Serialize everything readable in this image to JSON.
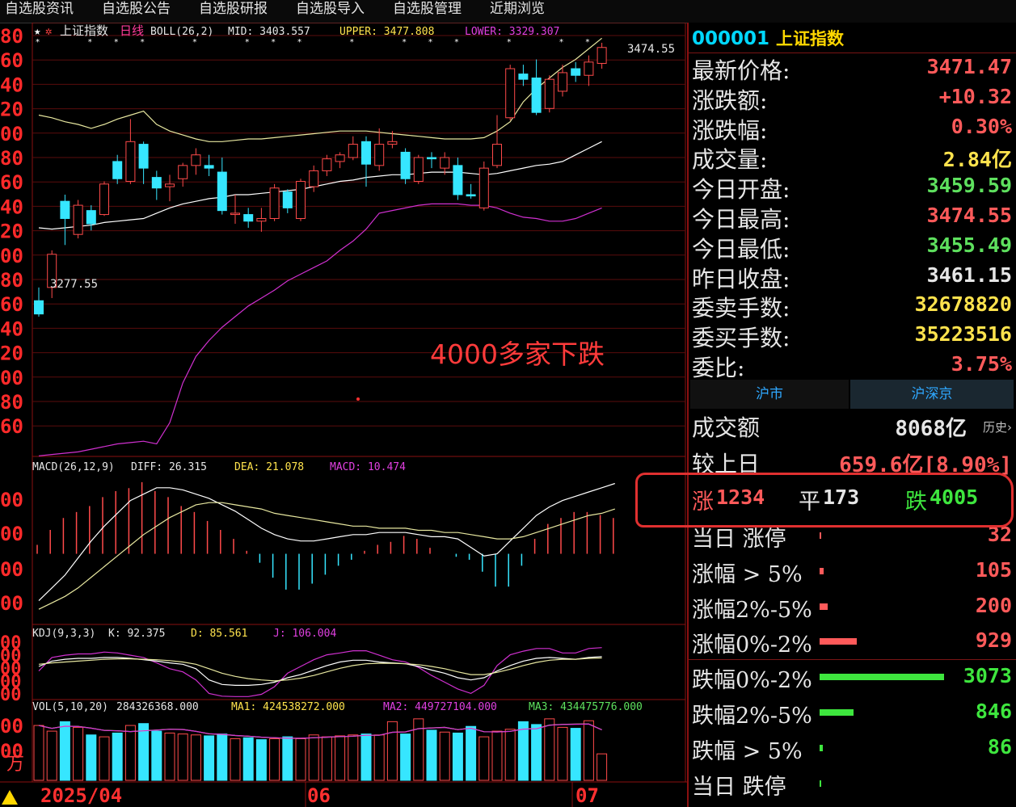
{
  "menu": [
    "自选股资讯",
    "自选股公告",
    "自选股研报",
    "自选股导入",
    "自选股管理",
    "近期浏览"
  ],
  "main_chart": {
    "star_label": "★",
    "title": "上证指数",
    "period": "日线",
    "indicator": "BOLL(26,2)",
    "mid": "MID: 3403.557",
    "upper": "UPPER: 3477.808",
    "lower": "LOWER: 3329.307",
    "high_marker": "3474.55",
    "low_marker": "3277.55",
    "y_tick_labels": [
      "80",
      "60",
      "40",
      "20",
      "00",
      "80",
      "60",
      "40",
      "20",
      "00",
      "80",
      "60",
      "40",
      "20",
      "00",
      "80",
      "60"
    ],
    "candles": [
      {
        "o": 3280,
        "c": 3270,
        "h": 3290,
        "l": 3268
      },
      {
        "o": 3290,
        "c": 3315,
        "h": 3318,
        "l": 3282
      },
      {
        "o": 3355,
        "c": 3342,
        "h": 3360,
        "l": 3322
      },
      {
        "o": 3330,
        "c": 3352,
        "h": 3356,
        "l": 3327
      },
      {
        "o": 3348,
        "c": 3338,
        "h": 3352,
        "l": 3333
      },
      {
        "o": 3345,
        "c": 3368,
        "h": 3370,
        "l": 3344
      },
      {
        "o": 3385,
        "c": 3372,
        "h": 3390,
        "l": 3368
      },
      {
        "o": 3370,
        "c": 3400,
        "h": 3417,
        "l": 3368
      },
      {
        "o": 3398,
        "c": 3380,
        "h": 3400,
        "l": 3368
      },
      {
        "o": 3373,
        "c": 3365,
        "h": 3378,
        "l": 3356
      },
      {
        "o": 3366,
        "c": 3368,
        "h": 3375,
        "l": 3355
      },
      {
        "o": 3372,
        "c": 3382,
        "h": 3384,
        "l": 3366
      },
      {
        "o": 3382,
        "c": 3390,
        "h": 3395,
        "l": 3375
      },
      {
        "o": 3382,
        "c": 3380,
        "h": 3390,
        "l": 3374
      },
      {
        "o": 3377,
        "c": 3348,
        "h": 3388,
        "l": 3345
      },
      {
        "o": 3345,
        "c": 3346,
        "h": 3360,
        "l": 3338
      },
      {
        "o": 3345,
        "c": 3340,
        "h": 3350,
        "l": 3335
      },
      {
        "o": 3340,
        "c": 3342,
        "h": 3350,
        "l": 3332
      },
      {
        "o": 3342,
        "c": 3365,
        "h": 3368,
        "l": 3340
      },
      {
        "o": 3362,
        "c": 3350,
        "h": 3364,
        "l": 3346
      },
      {
        "o": 3342,
        "c": 3370,
        "h": 3372,
        "l": 3340
      },
      {
        "o": 3366,
        "c": 3378,
        "h": 3382,
        "l": 3362
      },
      {
        "o": 3378,
        "c": 3387,
        "h": 3390,
        "l": 3374
      },
      {
        "o": 3385,
        "c": 3390,
        "h": 3392,
        "l": 3380
      },
      {
        "o": 3388,
        "c": 3398,
        "h": 3404,
        "l": 3386
      },
      {
        "o": 3400,
        "c": 3383,
        "h": 3404,
        "l": 3366
      },
      {
        "o": 3382,
        "c": 3398,
        "h": 3410,
        "l": 3378
      },
      {
        "o": 3398,
        "c": 3400,
        "h": 3408,
        "l": 3395
      },
      {
        "o": 3392,
        "c": 3372,
        "h": 3395,
        "l": 3368
      },
      {
        "o": 3370,
        "c": 3388,
        "h": 3390,
        "l": 3368
      },
      {
        "o": 3388,
        "c": 3387,
        "h": 3392,
        "l": 3380
      },
      {
        "o": 3380,
        "c": 3388,
        "h": 3392,
        "l": 3375
      },
      {
        "o": 3382,
        "c": 3360,
        "h": 3388,
        "l": 3356
      },
      {
        "o": 3360,
        "c": 3359,
        "h": 3368,
        "l": 3357
      },
      {
        "o": 3350,
        "c": 3380,
        "h": 3385,
        "l": 3348
      },
      {
        "o": 3382,
        "c": 3398,
        "h": 3420,
        "l": 3380
      },
      {
        "o": 3418,
        "c": 3455,
        "h": 3458,
        "l": 3416
      },
      {
        "o": 3451,
        "c": 3447,
        "h": 3458,
        "l": 3442
      },
      {
        "o": 3448,
        "c": 3422,
        "h": 3462,
        "l": 3420
      },
      {
        "o": 3425,
        "c": 3447,
        "h": 3450,
        "l": 3422
      },
      {
        "o": 3438,
        "c": 3452,
        "h": 3458,
        "l": 3434
      },
      {
        "o": 3455,
        "c": 3450,
        "h": 3460,
        "l": 3445
      },
      {
        "o": 3450,
        "c": 3460,
        "h": 3465,
        "l": 3442
      },
      {
        "o": 3459,
        "c": 3471,
        "h": 3474.55,
        "l": 3455
      }
    ],
    "mid_line": [
      3335,
      3334,
      3335,
      3336,
      3337,
      3339,
      3340,
      3341,
      3342,
      3346,
      3350,
      3353,
      3355,
      3357,
      3358,
      3360,
      3360,
      3361,
      3362,
      3363,
      3364,
      3366,
      3368,
      3370,
      3371,
      3373,
      3374,
      3375,
      3375,
      3376,
      3377,
      3377,
      3377,
      3376,
      3375,
      3376,
      3378,
      3380,
      3382,
      3383,
      3385,
      3390,
      3395,
      3400
    ],
    "upper_line": [
      3420,
      3418,
      3415,
      3413,
      3410,
      3413,
      3417,
      3420,
      3423,
      3413,
      3408,
      3405,
      3402,
      3400,
      3400,
      3401,
      3402,
      3402,
      3403,
      3404,
      3405,
      3406,
      3407,
      3408,
      3408,
      3408,
      3407,
      3406,
      3405,
      3404,
      3403,
      3402,
      3402,
      3402,
      3403,
      3408,
      3415,
      3430,
      3440,
      3448,
      3456,
      3462,
      3470,
      3478
    ],
    "lower_line": [
      3163,
      3164,
      3165,
      3166,
      3168,
      3170,
      3172,
      3173,
      3174,
      3172,
      3188,
      3218,
      3238,
      3250,
      3260,
      3268,
      3276,
      3282,
      3288,
      3295,
      3300,
      3305,
      3310,
      3318,
      3325,
      3334,
      3346,
      3348,
      3350,
      3352,
      3353,
      3353,
      3353,
      3352,
      3352,
      3350,
      3346,
      3343,
      3342,
      3340,
      3340,
      3342,
      3346,
      3350
    ],
    "annotation": "4000多家下跌"
  },
  "macd": {
    "label": "MACD(26,12,9)",
    "diff": "DIFF: 26.315",
    "dea": "DEA: 21.078",
    "macd": "MACD: 10.474",
    "y_tick_labels": [
      "00",
      "00",
      "00",
      "00"
    ],
    "hist": [
      3,
      8,
      12,
      14,
      16,
      19,
      21,
      22,
      24,
      21,
      19,
      16,
      14,
      11,
      8,
      5,
      1,
      -3,
      -8,
      -12,
      -12,
      -10,
      -7,
      -4,
      -2,
      1,
      3,
      4,
      6,
      5,
      2,
      0,
      -1,
      -2,
      -6,
      -11,
      -11,
      -4,
      5,
      10,
      12,
      14,
      14,
      13,
      12
    ],
    "diff_line": [
      -22,
      -16,
      -10,
      -2,
      6,
      13,
      19,
      25,
      28,
      31,
      31,
      30,
      28,
      26,
      23,
      20,
      16,
      12,
      9,
      7,
      6,
      6,
      7,
      8,
      9,
      9,
      10,
      10,
      10,
      9,
      8,
      8,
      7,
      3,
      -1,
      0,
      6,
      12,
      18,
      22,
      25,
      27,
      29,
      31,
      33
    ],
    "dea_line": [
      -26,
      -23,
      -20,
      -16,
      -11,
      -6,
      -1,
      4,
      9,
      13,
      17,
      20,
      23,
      24,
      24,
      23,
      22,
      21,
      19,
      18,
      17,
      16,
      15,
      14,
      13,
      13,
      12,
      12,
      12,
      11,
      11,
      10,
      10,
      9,
      8,
      7,
      7,
      8,
      10,
      12,
      14,
      16,
      18,
      19,
      21
    ]
  },
  "kdj": {
    "label": "KDJ(9,3,3)",
    "k": "K: 92.375",
    "d": "D: 85.561",
    "j": "J: 106.004",
    "y_tick_labels": [
      "00",
      "00",
      "00",
      "00",
      "00"
    ],
    "k_line": [
      70,
      82,
      86,
      88,
      88,
      90,
      90,
      88,
      85,
      82,
      78,
      75,
      65,
      40,
      30,
      28,
      28,
      30,
      35,
      45,
      52,
      62,
      72,
      80,
      84,
      84,
      80,
      78,
      76,
      70,
      62,
      55,
      45,
      40,
      45,
      60,
      72,
      82,
      88,
      90,
      88,
      86,
      90,
      92
    ],
    "d_line": [
      75,
      78,
      80,
      82,
      84,
      86,
      87,
      87,
      86,
      85,
      83,
      80,
      75,
      65,
      55,
      48,
      43,
      40,
      38,
      40,
      44,
      50,
      58,
      66,
      72,
      76,
      77,
      77,
      76,
      74,
      70,
      65,
      58,
      52,
      52,
      57,
      64,
      72,
      79,
      84,
      86,
      86,
      88,
      89
    ],
    "j_line": [
      60,
      90,
      95,
      98,
      98,
      102,
      100,
      95,
      90,
      78,
      65,
      58,
      40,
      10,
      4,
      3,
      3,
      8,
      25,
      55,
      70,
      85,
      96,
      100,
      105,
      105,
      95,
      85,
      80,
      68,
      50,
      35,
      20,
      10,
      28,
      72,
      96,
      104,
      110,
      110,
      100,
      100,
      110,
      112
    ]
  },
  "vol": {
    "label": "VOL(5,10,20)",
    "value": "284326368.000",
    "ma1": "MA1: 424538272.000",
    "ma2": "MA2: 449727104.000",
    "ma3": "MA3: 434475776.000",
    "y_tick_labels": [
      "00",
      "00"
    ],
    "unit": "万",
    "bars": [
      5.8,
      5.2,
      6.2,
      5.6,
      4.8,
      4.6,
      5.0,
      5.8,
      6.0,
      5.2,
      5.0,
      4.9,
      4.8,
      4.7,
      4.9,
      4.4,
      4.5,
      4.3,
      4.4,
      4.6,
      4.4,
      4.8,
      4.6,
      4.7,
      4.8,
      4.9,
      4.8,
      6.2,
      4.9,
      6.5,
      5.3,
      5.1,
      5.0,
      5.7,
      4.6,
      5.2,
      5.4,
      6.2,
      5.9,
      6.5,
      5.6,
      5.5,
      6.3,
      2.8
    ],
    "up": [
      true,
      true,
      false,
      true,
      false,
      true,
      false,
      true,
      false,
      false,
      true,
      true,
      true,
      false,
      false,
      true,
      false,
      false,
      true,
      false,
      true,
      true,
      true,
      true,
      true,
      false,
      true,
      true,
      false,
      true,
      false,
      true,
      false,
      false,
      true,
      true,
      true,
      false,
      false,
      true,
      true,
      false,
      true,
      true
    ]
  },
  "x_axis": {
    "labels": [
      "2025/04",
      "06",
      "07"
    ]
  },
  "right_panel": {
    "code": "000001",
    "name": "上证指数",
    "quotes": [
      {
        "label": "最新价格:",
        "value": "3471.47",
        "color": "#ff5a5a"
      },
      {
        "label": "涨跌额:",
        "value": "+10.32",
        "color": "#ff5a5a"
      },
      {
        "label": "涨跌幅:",
        "value": "0.30%",
        "color": "#ff5a5a"
      },
      {
        "label": "成交量:",
        "value": "2.84亿",
        "color": "#ffe34d"
      },
      {
        "label": "今日开盘:",
        "value": "3459.59",
        "color": "#5ee05e"
      },
      {
        "label": "今日最高:",
        "value": "3474.55",
        "color": "#ff5a5a"
      },
      {
        "label": "今日最低:",
        "value": "3455.49",
        "color": "#5ee05e"
      },
      {
        "label": "昨日收盘:",
        "value": "3461.15",
        "color": "#e6e6e6"
      },
      {
        "label": "委卖手数:",
        "value": "32678820",
        "color": "#ffe34d"
      },
      {
        "label": "委买手数:",
        "value": "35223516",
        "color": "#ffe34d"
      },
      {
        "label": "委比:",
        "value": "3.75%",
        "color": "#ff5a5a"
      }
    ],
    "tabs": [
      "沪市",
      "沪深京"
    ],
    "turnover_label": "成交额",
    "turnover_value": "8068亿",
    "history_link": "历史›",
    "compare_label": "较上日",
    "compare_value": "659.6亿[8.90%]",
    "up_label": "涨",
    "up_count": "1234",
    "flat_label": "平",
    "flat_count": "173",
    "down_label": "跌",
    "down_count": "4005",
    "distribution": [
      {
        "label": "当日 涨停",
        "value": "32",
        "color": "#ff5a5a",
        "share": 0.01
      },
      {
        "label": "涨幅 > 5%",
        "value": "105",
        "color": "#ff5a5a",
        "share": 0.03
      },
      {
        "label": "涨幅2%-5%",
        "value": "200",
        "color": "#ff5a5a",
        "share": 0.065
      },
      {
        "label": "涨幅0%-2%",
        "value": "929",
        "color": "#ff5a5a",
        "share": 0.3
      },
      {
        "label": "跌幅0%-2%",
        "value": "3073",
        "color": "#3ee63e",
        "share": 1.0
      },
      {
        "label": "跌幅2%-5%",
        "value": "846",
        "color": "#3ee63e",
        "share": 0.275
      },
      {
        "label": "跌幅 > 5%",
        "value": "86",
        "color": "#3ee63e",
        "share": 0.028
      },
      {
        "label": "当日 跌停",
        "value": "",
        "color": "#3ee63e",
        "share": 0
      }
    ]
  }
}
